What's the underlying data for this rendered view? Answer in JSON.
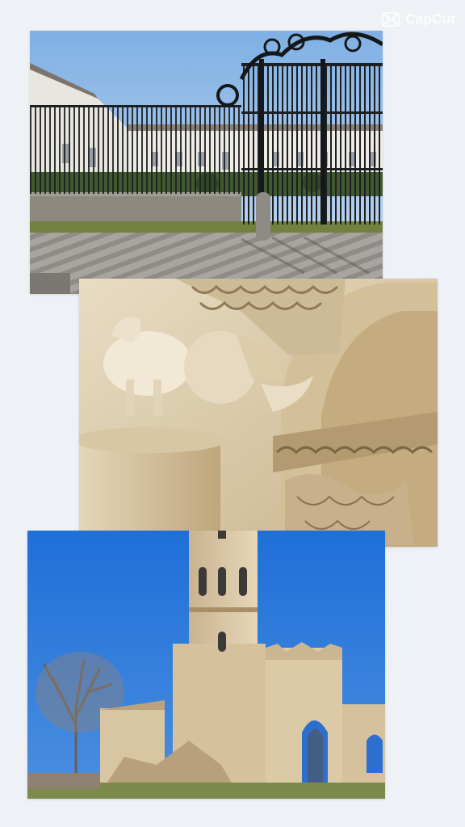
{
  "watermark": {
    "text": "CapCut",
    "icon": "capcut-logo-icon"
  },
  "photos": [
    {
      "name": "gate",
      "scene": "wrought-iron-gate-courtyard"
    },
    {
      "name": "capital",
      "scene": "romanesque-carved-capital"
    },
    {
      "name": "abbey",
      "scene": "abbey-ruins-bell-tower"
    }
  ],
  "colors": {
    "background": "#eef1f5",
    "sky": "#2f79d6",
    "stone": "#d9c6a2"
  }
}
